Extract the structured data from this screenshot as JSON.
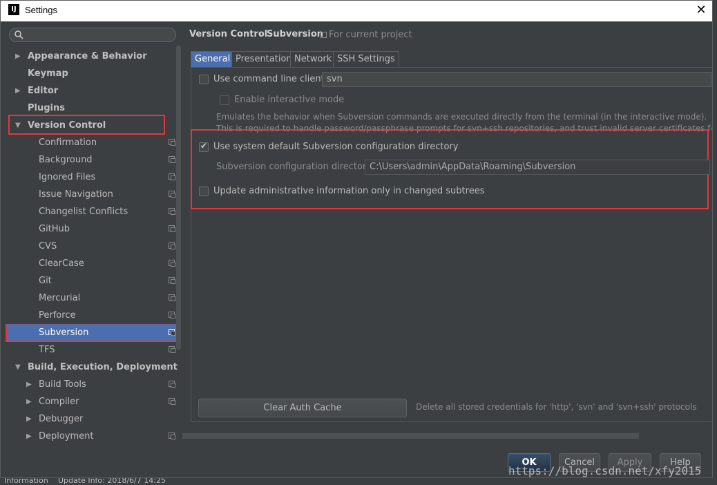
{
  "window": {
    "title": "Settings",
    "app_icon": "intellij-icon"
  },
  "sidebar": {
    "search_placeholder": "",
    "items": [
      {
        "label": "Appearance & Behavior"
      },
      {
        "label": "Keymap"
      },
      {
        "label": "Editor"
      },
      {
        "label": "Plugins"
      },
      {
        "label": "Version Control"
      },
      {
        "label": "Confirmation"
      },
      {
        "label": "Background"
      },
      {
        "label": "Ignored Files"
      },
      {
        "label": "Issue Navigation"
      },
      {
        "label": "Changelist Conflicts"
      },
      {
        "label": "GitHub"
      },
      {
        "label": "CVS"
      },
      {
        "label": "ClearCase"
      },
      {
        "label": "Git"
      },
      {
        "label": "Mercurial"
      },
      {
        "label": "Perforce"
      },
      {
        "label": "Subversion"
      },
      {
        "label": "TFS"
      },
      {
        "label": "Build, Execution, Deployment"
      },
      {
        "label": "Build Tools"
      },
      {
        "label": "Compiler"
      },
      {
        "label": "Debugger"
      },
      {
        "label": "Deployment"
      }
    ]
  },
  "breadcrumb": {
    "parent": "Version Control",
    "separator": "›",
    "current": "Subversion",
    "scope": "For current project"
  },
  "tabs": [
    "General",
    "Presentation",
    "Network",
    "SSH Settings"
  ],
  "general": {
    "use_cmd_client_label": "Use command line client:",
    "use_cmd_client_value": "svn",
    "enable_interactive_label": "Enable interactive mode",
    "desc_line1": "Emulates the behavior when Subversion commands are executed directly from the terminal (in the interactive mode).",
    "desc_line2": "This is required to handle password/passphrase prompts for svn+ssh repositories, and trust invalid server certificates for h",
    "use_default_dir_label": "Use system default Subversion configuration directory",
    "config_dir_label": "Subversion configuration directory:",
    "config_dir_value": "C:\\Users\\admin\\AppData\\Roaming\\Subversion",
    "update_admin_label": "Update administrative information only in changed subtrees",
    "clear_cache_label": "Clear Auth Cache",
    "clear_cache_desc": "Delete all stored credentials for 'http', 'svn' and 'svn+ssh' protocols"
  },
  "footer": {
    "ok": "OK",
    "cancel": "Cancel",
    "apply": "Apply",
    "help": "Help"
  },
  "statusbar": {
    "left": "Information",
    "right": "Update Info: 2018/6/7 14:25"
  },
  "watermark": "https://blog.csdn.net/xfy2015",
  "colors": {
    "selection": "#4b6eaf",
    "highlight_box": "#e0383e",
    "background": "#3c3f41"
  }
}
